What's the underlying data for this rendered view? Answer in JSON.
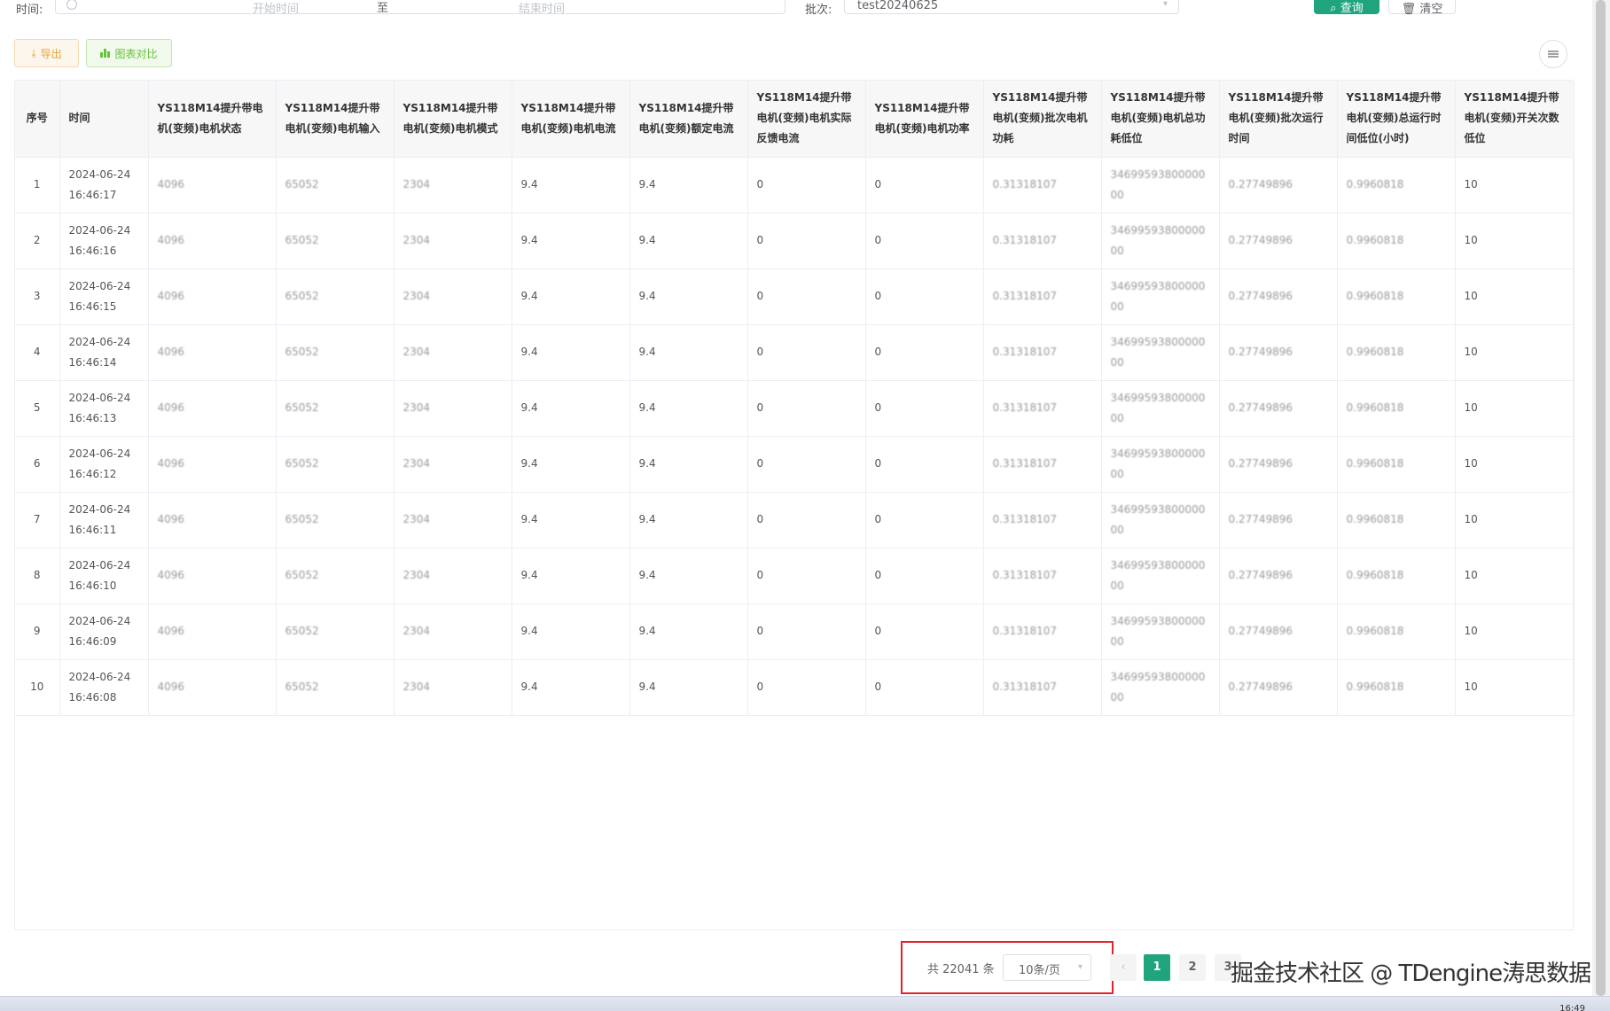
{
  "search": {
    "time_label": "时间:",
    "start_placeholder": "开始时间",
    "separator": "至",
    "end_placeholder": "结束时间",
    "batch_label": "批次:",
    "batch_value": "test20240625",
    "query_label": "查询",
    "clear_label": "清空"
  },
  "toolbar": {
    "export_label": "导出",
    "chart_compare_label": "图表对比"
  },
  "table": {
    "columns": [
      "序号",
      "时间",
      "YS118M14提升带电机(变频)电机状态",
      "YS118M14提升带电机(变频)电机输入",
      "YS118M14提升带电机(变频)电机模式",
      "YS118M14提升带电机(变频)电机电流",
      "YS118M14提升带电机(变频)额定电流",
      "YS118M14提升带电机(变频)电机实际反馈电流",
      "YS118M14提升带电机(变频)电机功率",
      "YS118M14提升带电机(变频)批次电机功耗",
      "YS118M14提升带电机(变频)电机总功耗低位",
      "YS118M14提升带电机(变频)批次运行时间",
      "YS118M14提升带电机(变频)总运行时间低位(小时)",
      "YS118M14提升带电机(变频)开关次数低位"
    ],
    "rows": [
      [
        "1",
        "2024-06-24 16:46:17",
        "4096",
        "65052",
        "2304",
        "9.4",
        "9.4",
        "0",
        "0",
        "0.31318107",
        "3469959380000000",
        "0.27749896",
        "0.9960818",
        "10"
      ],
      [
        "2",
        "2024-06-24 16:46:16",
        "4096",
        "65052",
        "2304",
        "9.4",
        "9.4",
        "0",
        "0",
        "0.31318107",
        "3469959380000000",
        "0.27749896",
        "0.9960818",
        "10"
      ],
      [
        "3",
        "2024-06-24 16:46:15",
        "4096",
        "65052",
        "2304",
        "9.4",
        "9.4",
        "0",
        "0",
        "0.31318107",
        "3469959380000000",
        "0.27749896",
        "0.9960818",
        "10"
      ],
      [
        "4",
        "2024-06-24 16:46:14",
        "4096",
        "65052",
        "2304",
        "9.4",
        "9.4",
        "0",
        "0",
        "0.31318107",
        "3469959380000000",
        "0.27749896",
        "0.9960818",
        "10"
      ],
      [
        "5",
        "2024-06-24 16:46:13",
        "4096",
        "65052",
        "2304",
        "9.4",
        "9.4",
        "0",
        "0",
        "0.31318107",
        "3469959380000000",
        "0.27749896",
        "0.9960818",
        "10"
      ],
      [
        "6",
        "2024-06-24 16:46:12",
        "4096",
        "65052",
        "2304",
        "9.4",
        "9.4",
        "0",
        "0",
        "0.31318107",
        "3469959380000000",
        "0.27749896",
        "0.9960818",
        "10"
      ],
      [
        "7",
        "2024-06-24 16:46:11",
        "4096",
        "65052",
        "2304",
        "9.4",
        "9.4",
        "0",
        "0",
        "0.31318107",
        "3469959380000000",
        "0.27749896",
        "0.9960818",
        "10"
      ],
      [
        "8",
        "2024-06-24 16:46:10",
        "4096",
        "65052",
        "2304",
        "9.4",
        "9.4",
        "0",
        "0",
        "0.31318107",
        "3469959380000000",
        "0.27749896",
        "0.9960818",
        "10"
      ],
      [
        "9",
        "2024-06-24 16:46:09",
        "4096",
        "65052",
        "2304",
        "9.4",
        "9.4",
        "0",
        "0",
        "0.31318107",
        "3469959380000000",
        "0.27749896",
        "0.9960818",
        "10"
      ],
      [
        "10",
        "2024-06-24 16:46:08",
        "4096",
        "65052",
        "2304",
        "9.4",
        "9.4",
        "0",
        "0",
        "0.31318107",
        "3469959380000000",
        "0.27749896",
        "0.9960818",
        "10"
      ]
    ]
  },
  "pagination": {
    "total_text": "共 22041 条",
    "page_size": "10条/页",
    "pages": [
      "1",
      "2",
      "3"
    ],
    "current_page": "1"
  },
  "watermark": "掘金技术社区 @ TDengine涛思数据",
  "taskbar": {
    "time": "16:49"
  },
  "colors": {
    "primary": "#1fa47e",
    "export_text": "#e6a23c",
    "chart_text": "#67c23a",
    "highlight_box": "#e0242a"
  },
  "icons": {
    "clock": "clock-icon",
    "export": "download-icon",
    "chart": "bar-chart-icon",
    "settings": "sliders-icon",
    "prev": "chevron-left-icon",
    "dropdown": "chevron-down-icon"
  }
}
